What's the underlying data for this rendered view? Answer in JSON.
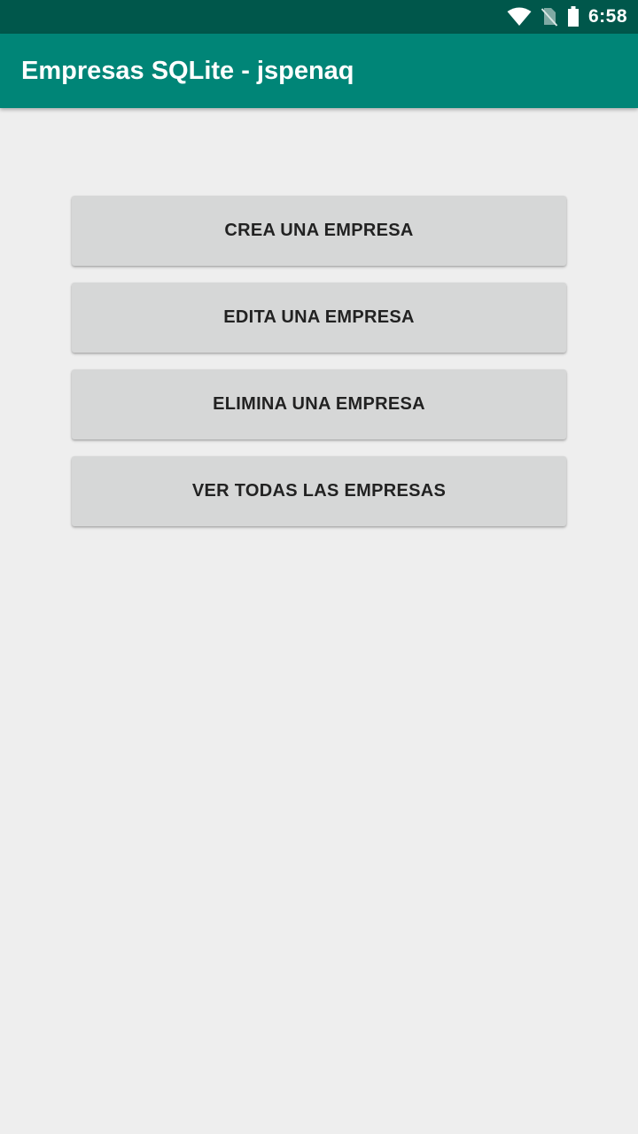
{
  "status_bar": {
    "time": "6:58",
    "icons": [
      "wifi-icon",
      "no-sim-icon",
      "battery-icon"
    ]
  },
  "app_bar": {
    "title": "Empresas SQLite - jspenaq",
    "background_color": "#008577"
  },
  "main": {
    "buttons": [
      {
        "label": "CREA UNA EMPRESA"
      },
      {
        "label": "EDITA UNA EMPRESA"
      },
      {
        "label": "ELIMINA UNA EMPRESA"
      },
      {
        "label": "VER TODAS LAS EMPRESAS"
      }
    ]
  },
  "colors": {
    "status_bar": "#00574b",
    "app_bar": "#008577",
    "background": "#eeeeee",
    "button": "#d6d7d7"
  }
}
